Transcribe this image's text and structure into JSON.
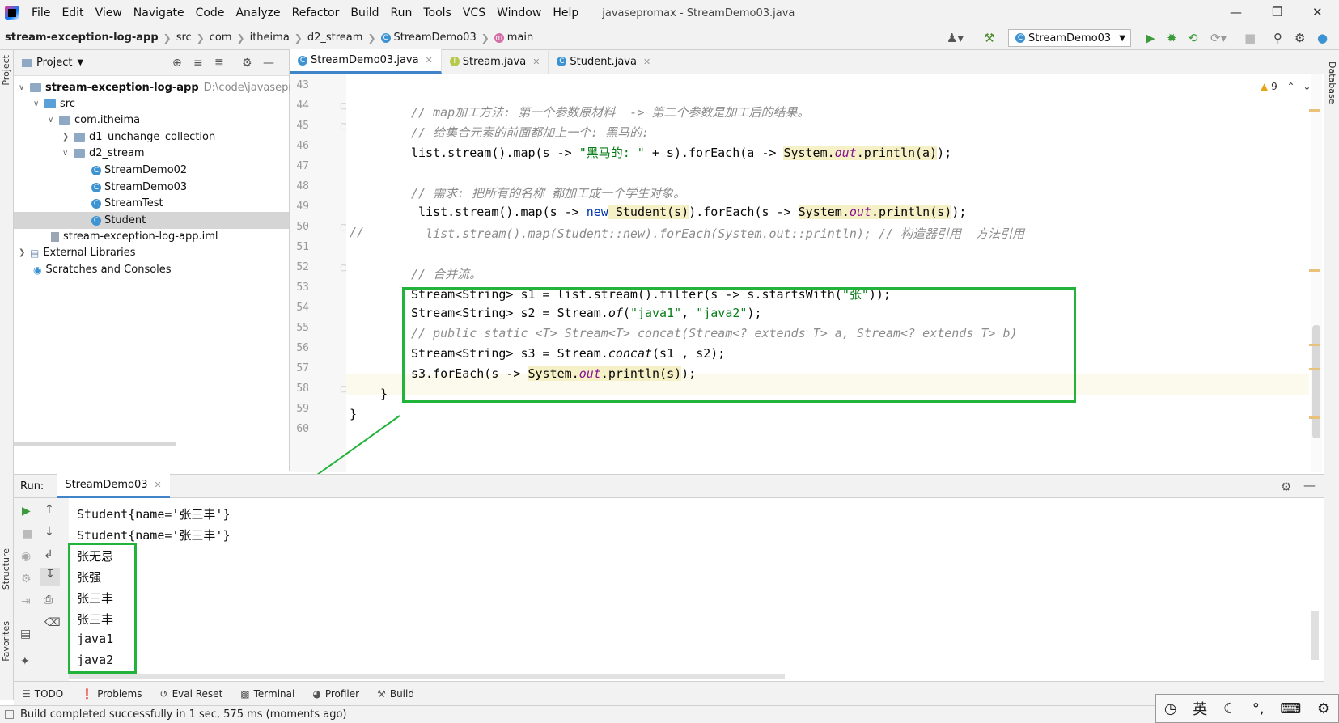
{
  "menubar": {
    "items": [
      "File",
      "Edit",
      "View",
      "Navigate",
      "Code",
      "Analyze",
      "Refactor",
      "Build",
      "Run",
      "Tools",
      "VCS",
      "Window",
      "Help"
    ],
    "title": "javasepromax - StreamDemo03.java"
  },
  "breadcrumb": {
    "items": [
      "stream-exception-log-app",
      "src",
      "com",
      "itheima",
      "d2_stream",
      "StreamDemo03",
      "main"
    ]
  },
  "toolbar": {
    "run_config": "StreamDemo03"
  },
  "project": {
    "header": "Project",
    "tree": [
      {
        "label": "stream-exception-log-app",
        "extra": "D:\\code\\javasepro"
      },
      {
        "label": "src"
      },
      {
        "label": "com.itheima"
      },
      {
        "label": "d1_unchange_collection"
      },
      {
        "label": "d2_stream"
      },
      {
        "label": "StreamDemo02"
      },
      {
        "label": "StreamDemo03"
      },
      {
        "label": "StreamTest"
      },
      {
        "label": "Student"
      },
      {
        "label": "stream-exception-log-app.iml"
      },
      {
        "label": "External Libraries"
      },
      {
        "label": "Scratches and Consoles"
      }
    ]
  },
  "tabs": [
    {
      "label": "StreamDemo03.java"
    },
    {
      "label": "Stream.java"
    },
    {
      "label": "Student.java"
    }
  ],
  "editor": {
    "line_numbers": [
      "43",
      "44",
      "45",
      "46",
      "47",
      "48",
      "49",
      "50",
      "51",
      "52",
      "53",
      "54",
      "55",
      "56",
      "57",
      "58",
      "59",
      "60"
    ],
    "warnings": "9",
    "l44": "// map加工方法: 第一个参数原材料  -> 第二个参数是加工后的结果。",
    "l45": "// 给集合元素的前面都加上一个: 黑马的:",
    "l46a": "list.stream().map(s -> ",
    "l46s": "\"黑马的: \"",
    "l46b": " + s).forEach(a -> ",
    "l46c": "System.",
    "l46d": "out",
    "l46e": ".println(a)",
    "l46f": ");",
    "l48": "// 需求: 把所有的名称 都加工成一个学生对象。",
    "l49a": " list.stream().map(s -> ",
    "l49k": "new",
    "l49b": " Student(s)",
    "l49c": ").forEach(s -> ",
    "l49d": "System.",
    "l49e": "out",
    "l49f": ".println(s)",
    "l49g": ");",
    "l50p": "//",
    "l50": "  list.stream().map(Student::new).forEach(System.out::println); // 构造器引用  方法引用",
    "l52": "// 合并流。",
    "l53a": "Stream<String> s1 = list.stream().filter(s -> s.startsWith(",
    "l53s": "\"张\"",
    "l53b": "));",
    "l54a": "Stream<String> s2 = Stream.",
    "l54i": "of",
    "l54b": "(",
    "l54s1": "\"java1\"",
    "l54c": ", ",
    "l54s2": "\"java2\"",
    "l54d": ");",
    "l55": "// public static <T> Stream<T> concat(Stream<? extends T> a, Stream<? extends T> b)",
    "l56a": "Stream<String> s3 = Stream.",
    "l56i": "concat",
    "l56b": "(s1 , s2);",
    "l57a": "s3.forEach(s -> ",
    "l57b": "System.",
    "l57c": "out",
    "l57d": ".println(s)",
    "l57e": ");",
    "l58": "}",
    "l59": "}"
  },
  "run": {
    "label": "Run:",
    "tab": "StreamDemo03",
    "output": [
      "Student{name='张三丰'}",
      "Student{name='张三丰'}",
      "张无忌",
      "张强",
      "张三丰",
      "张三丰",
      "java1",
      "java2"
    ]
  },
  "bottom_tools": [
    "TODO",
    "Problems",
    "Eval Reset",
    "Terminal",
    "Profiler",
    "Build"
  ],
  "status": "Build completed successfully in 1 sec, 575 ms (moments ago)",
  "side_labels": {
    "project": "Project",
    "structure": "Structure",
    "favorites": "Favorites",
    "database": "Database"
  },
  "ime": {
    "lang": "英"
  },
  "colors": {
    "highlight_box": "#22b33a",
    "accent": "#4083c9"
  }
}
